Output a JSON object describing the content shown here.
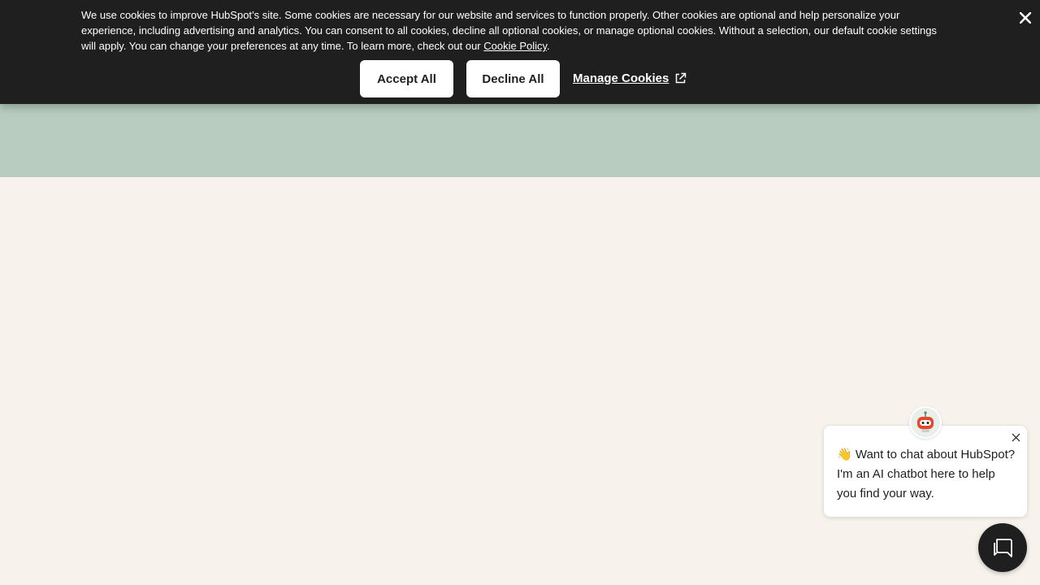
{
  "cookie_banner": {
    "text_before_link": "We use cookies to improve HubSpot’s site. Some cookies are necessary for our website and services to function properly. Other cookies are optional and help personalize your experience, including advertising and analytics. You can consent to all cookies, decline all optional cookies, or manage optional cookies. Without a selection, our default cookie settings will apply. You can change your preferences at any time. To learn more, check out our ",
    "policy_link": "Cookie Policy",
    "text_after_link": ".",
    "accept_label": "Accept All",
    "decline_label": "Decline All",
    "manage_label": "Manage Cookies",
    "close_icon": "close-icon",
    "external_icon": "external-link-icon"
  },
  "chat": {
    "greeting_emoji": "👋",
    "message": "Want to chat about HubSpot? I'm an AI chatbot here to help you find your way.",
    "avatar_icon": "robot-icon",
    "close_icon": "close-icon",
    "launcher_icon": "chat-icon"
  },
  "colors": {
    "banner_bg": "#1f1f1f",
    "band": "#b8cdbf",
    "page_bg": "#f7f3ec",
    "launcher_bg": "#1f1f1f"
  }
}
